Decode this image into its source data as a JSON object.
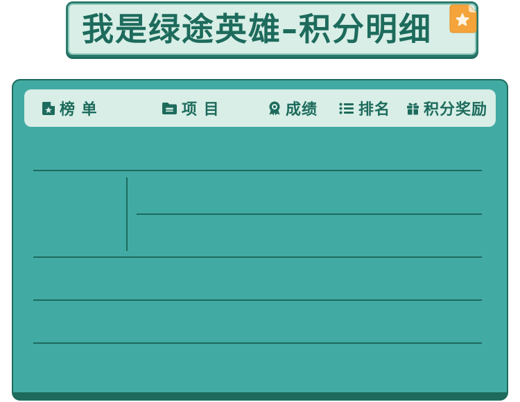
{
  "theme": {
    "card": "#41aaa3",
    "panel": "#d8eee6",
    "ink": "#1d6b5c",
    "badge": "#f4a43a"
  },
  "title": {
    "text": "我是绿途英雄–积分明细",
    "badge_icon": "star-icon"
  },
  "tabs": [
    {
      "label": "榜 单",
      "icon": "document-star-icon"
    },
    {
      "label": "项 目",
      "icon": "folder-icon"
    },
    {
      "label": "成绩",
      "icon": "medal-icon"
    },
    {
      "label": "排名",
      "icon": "list-icon"
    },
    {
      "label": "积分奖励",
      "icon": "gift-icon"
    }
  ]
}
